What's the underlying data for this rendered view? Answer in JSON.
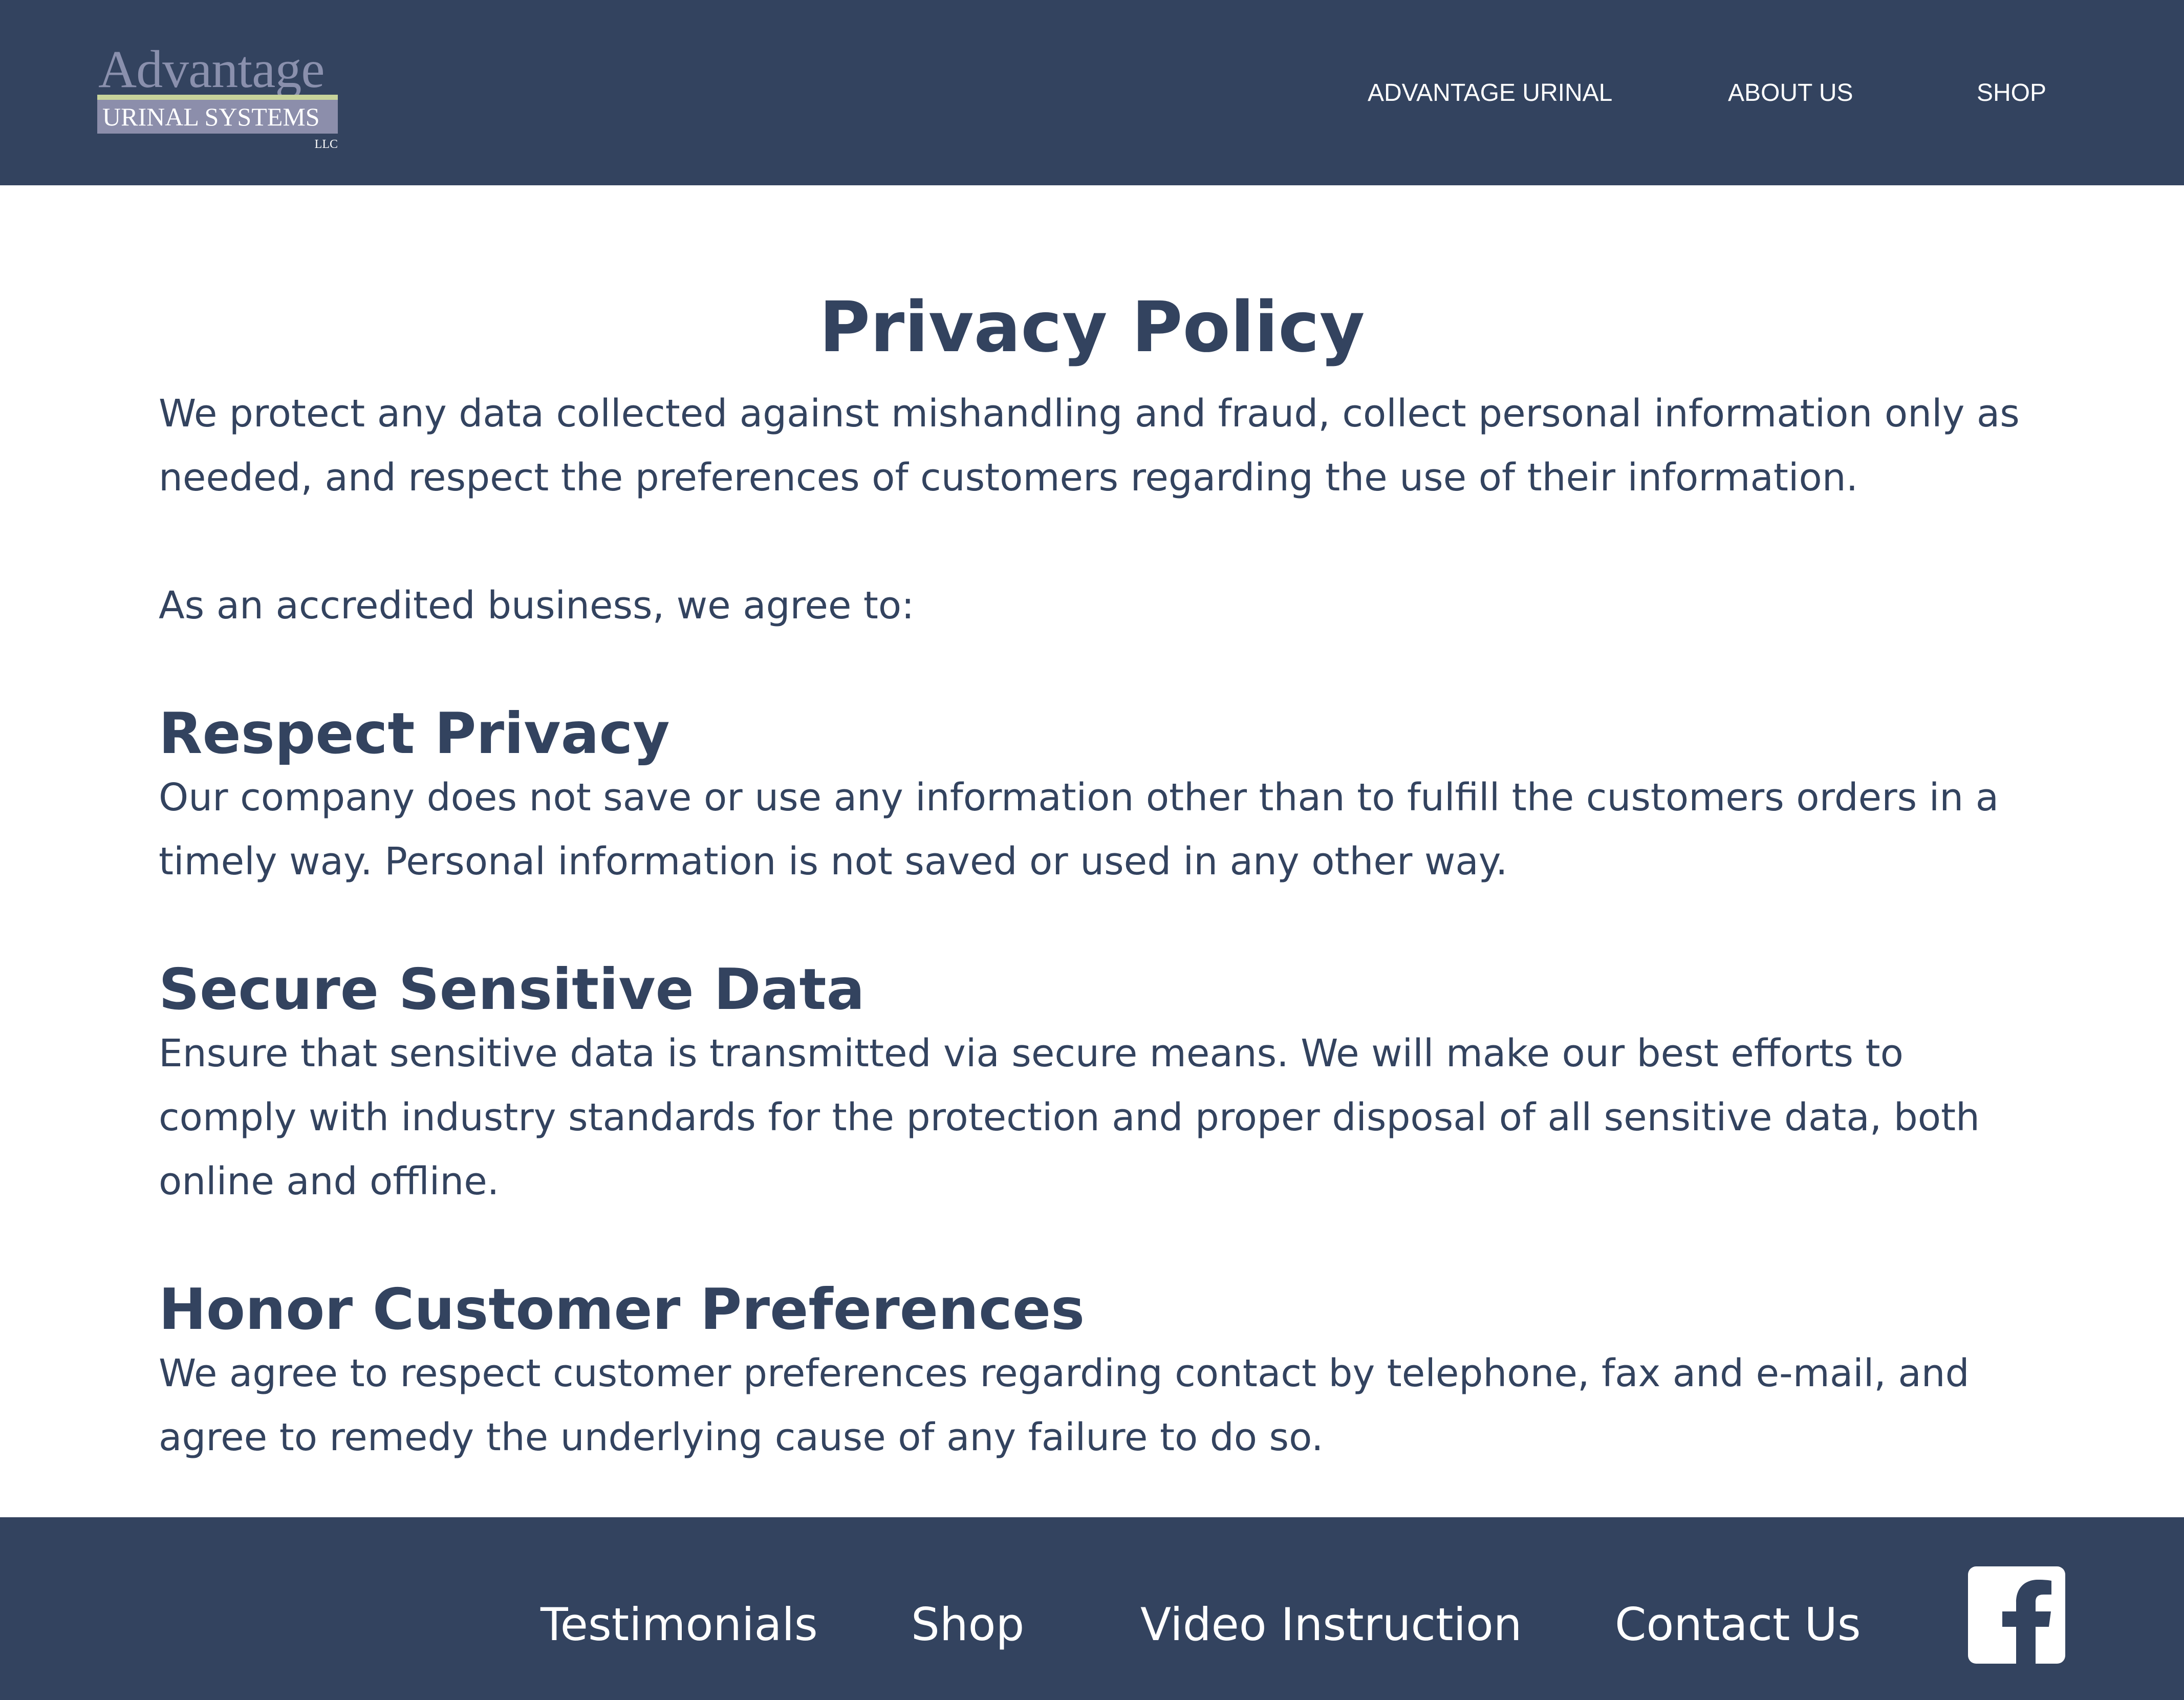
{
  "header": {
    "logo": {
      "word": "Advantage",
      "subtitle": "URINAL SYSTEMS",
      "suffix": "LLC"
    },
    "nav": [
      {
        "label": "ADVANTAGE URINAL"
      },
      {
        "label": "ABOUT US"
      },
      {
        "label": "SHOP"
      }
    ]
  },
  "main": {
    "title": "Privacy Policy",
    "intro": "We protect any data collected against mishandling and fraud, collect personal information only as needed, and respect the preferences of customers regarding the use of their information.",
    "lead": "As an accredited business, we agree to:",
    "sections": [
      {
        "heading": "Respect Privacy",
        "body": "Our company does not save or use any information other than to fulfill the customers orders in a timely way. Personal information is not saved or used in any other way."
      },
      {
        "heading": "Secure Sensitive Data",
        "body": "Ensure that sensitive data is transmitted via secure means. We will make our best efforts to comply with industry standards for the protection and proper disposal of all sensitive data, both online and offline."
      },
      {
        "heading": "Honor Customer Preferences",
        "body": "We agree to respect customer preferences regarding contact by telephone, fax and e-mail, and agree to remedy the underlying cause of any failure to do so."
      }
    ]
  },
  "footer": {
    "links": [
      {
        "label": "Testimonials"
      },
      {
        "label": "Shop"
      },
      {
        "label": "Video Instruction"
      },
      {
        "label": "Contact Us"
      }
    ],
    "social_icon": "facebook-icon"
  },
  "colors": {
    "brand_navy": "#33435f",
    "logo_lavender": "#8c8eab",
    "logo_green": "#c7d39b",
    "background": "#ffffff"
  }
}
